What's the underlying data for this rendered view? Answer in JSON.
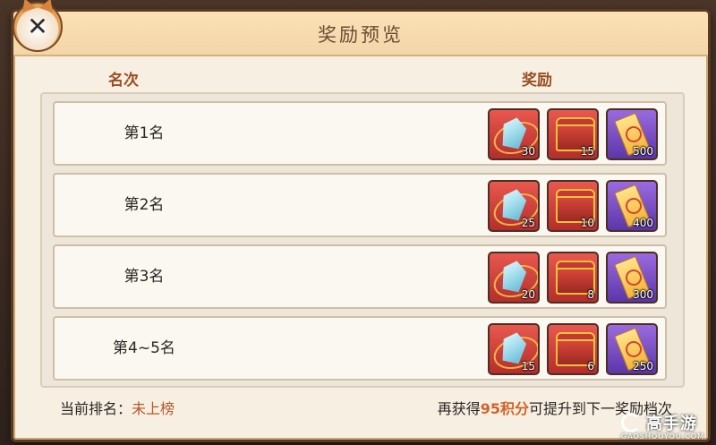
{
  "dialog": {
    "title": "奖励预览",
    "column_rank": "名次",
    "column_reward": "奖励"
  },
  "rows": [
    {
      "rank": "第1名",
      "rewards": [
        {
          "item": "crystal",
          "count": "30"
        },
        {
          "item": "chest",
          "count": "15"
        },
        {
          "item": "ticket",
          "count": "500"
        }
      ]
    },
    {
      "rank": "第2名",
      "rewards": [
        {
          "item": "crystal",
          "count": "25"
        },
        {
          "item": "chest",
          "count": "10"
        },
        {
          "item": "ticket",
          "count": "400"
        }
      ]
    },
    {
      "rank": "第3名",
      "rewards": [
        {
          "item": "crystal",
          "count": "20"
        },
        {
          "item": "chest",
          "count": "8"
        },
        {
          "item": "ticket",
          "count": "300"
        }
      ]
    },
    {
      "rank": "第4~5名",
      "rewards": [
        {
          "item": "crystal",
          "count": "15"
        },
        {
          "item": "chest",
          "count": "6"
        },
        {
          "item": "ticket",
          "count": "250"
        }
      ]
    }
  ],
  "footer": {
    "current_rank_label": "当前排名：",
    "current_rank_value": "未上榜",
    "need_prefix": "再获得",
    "need_points": "95积分",
    "need_suffix": "可提升到下一奖励档次"
  },
  "watermark": {
    "text": "高手游",
    "sub": "GAOSHOUYOU.COM"
  }
}
